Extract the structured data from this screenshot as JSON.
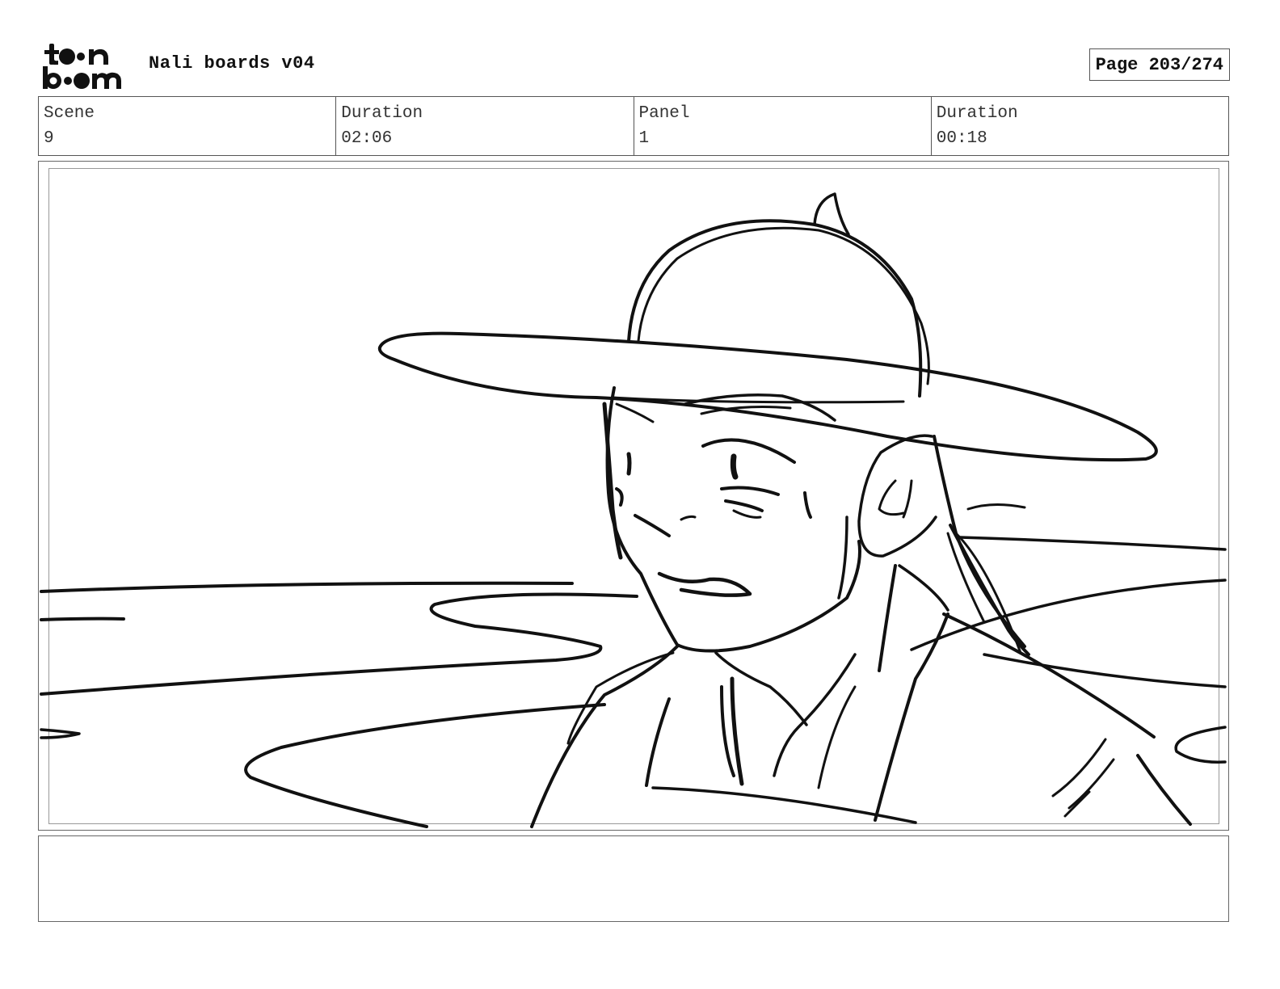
{
  "header": {
    "logo_icon": "toonboom-logo",
    "title": "Nali boards v04",
    "page_label": "Page 203/274"
  },
  "info": {
    "scene_label": "Scene",
    "scene_value": "9",
    "scene_duration_label": "Duration",
    "scene_duration_value": "02:06",
    "panel_label": "Panel",
    "panel_value": "1",
    "panel_duration_label": "Duration",
    "panel_duration_value": "00:18"
  },
  "panel": {
    "drawing": "sketch-character-wide-brim-hat"
  },
  "notes": {
    "text": ""
  }
}
